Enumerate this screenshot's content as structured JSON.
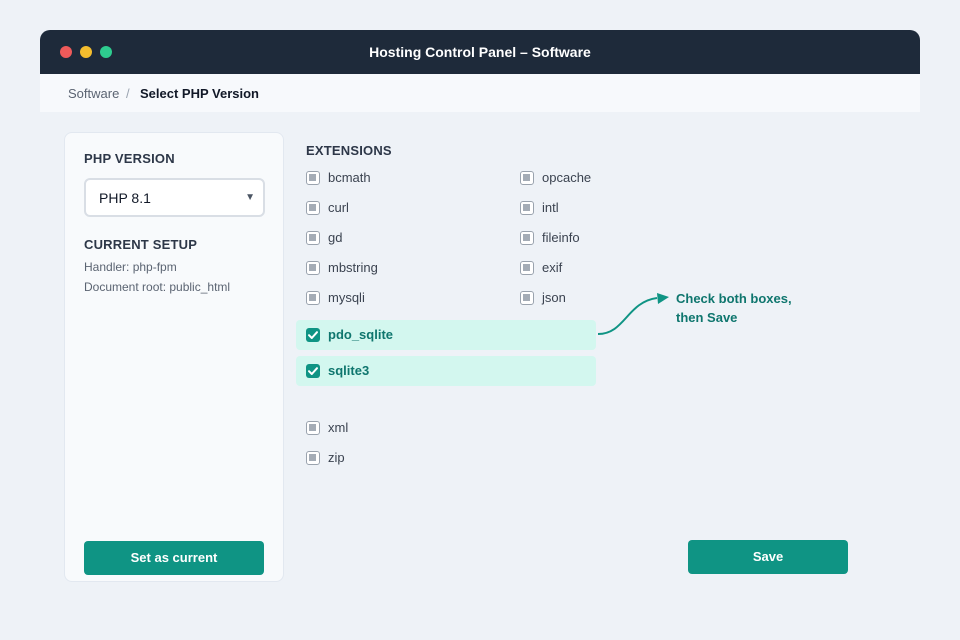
{
  "window": {
    "title": "Hosting Control Panel – Software"
  },
  "breadcrumb": {
    "parent": "Software",
    "separator": "/",
    "current": "Select PHP Version"
  },
  "sidebar": {
    "php_version_label": "PHP VERSION",
    "php_version_value": "PHP 8.1",
    "current_setup_label": "CURRENT SETUP",
    "handler": "Handler: php-fpm",
    "document_root": "Document root: public_html",
    "set_current_label": "Set as current"
  },
  "extensions": {
    "heading": "EXTENSIONS",
    "left_column": [
      "bcmath",
      "curl",
      "gd",
      "mbstring",
      "mysqli"
    ],
    "right_column": [
      "opcache",
      "intl",
      "fileinfo",
      "exif",
      "json"
    ],
    "highlighted": [
      {
        "name": "pdo_sqlite",
        "checked": true
      },
      {
        "name": "sqlite3",
        "checked": true
      }
    ],
    "bottom": [
      "xml",
      "zip"
    ]
  },
  "annotation": {
    "line1": "Check both boxes,",
    "line2": "then Save"
  },
  "actions": {
    "save_label": "Save"
  },
  "colors": {
    "accent": "#0f9484",
    "titlebar": "#1e2a3a",
    "highlight": "#d3f7ef"
  },
  "icons": {
    "select_caret": "chevron-down-icon",
    "checkmark": "check-icon"
  }
}
